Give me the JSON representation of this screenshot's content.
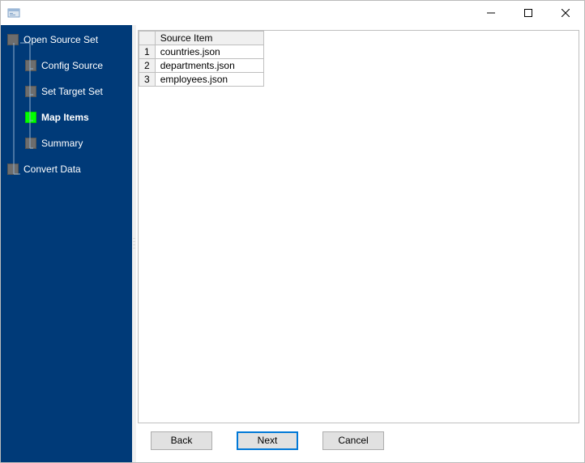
{
  "window": {
    "title": ""
  },
  "sidebar": {
    "items": [
      {
        "label": "Open Source Set",
        "indent": 0,
        "active": false
      },
      {
        "label": "Config Source",
        "indent": 1,
        "active": false
      },
      {
        "label": "Set Target Set",
        "indent": 1,
        "active": false
      },
      {
        "label": "Map Items",
        "indent": 1,
        "active": true
      },
      {
        "label": "Summary",
        "indent": 1,
        "active": false
      },
      {
        "label": "Convert Data",
        "indent": 0,
        "active": false
      }
    ]
  },
  "table": {
    "header": "Source Item",
    "rows": [
      {
        "num": "1",
        "value": "countries.json"
      },
      {
        "num": "2",
        "value": "departments.json"
      },
      {
        "num": "3",
        "value": "employees.json"
      }
    ]
  },
  "buttons": {
    "back": "Back",
    "next": "Next",
    "cancel": "Cancel"
  }
}
